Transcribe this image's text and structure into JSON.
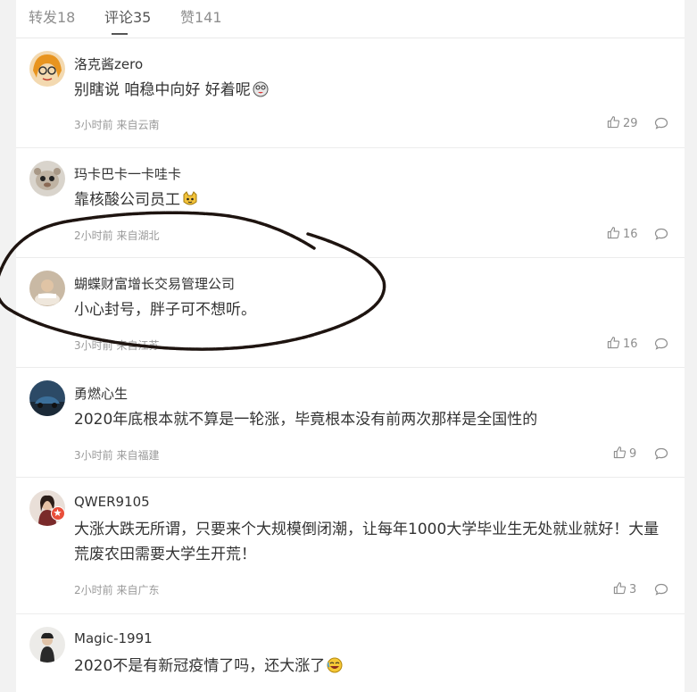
{
  "tabs": [
    {
      "label": "转发18"
    },
    {
      "label": "评论35"
    },
    {
      "label": "赞141"
    }
  ],
  "comments": [
    {
      "user": "洛克酱zero",
      "text": "别瞎说 咱稳中向好 好着呢",
      "meta": "3小时前 来自云南",
      "likes": "29"
    },
    {
      "user": "玛卡巴卡一卡哇卡",
      "text": "靠核酸公司员工",
      "meta": "2小时前 来自湖北",
      "likes": "16"
    },
    {
      "user": "蝴蝶财富增长交易管理公司",
      "text": "小心封号，胖子可不想听。",
      "meta": "3小时前 来自江苏",
      "likes": "16"
    },
    {
      "user": "勇燃心生",
      "text": "2020年底根本就不算是一轮涨，毕竟根本没有前两次那样是全国性的",
      "meta": "3小时前 来自福建",
      "likes": "9"
    },
    {
      "user": "QWER9105",
      "text": "大涨大跌无所谓，只要来个大规模倒闭潮，让每年1000大学毕业生无处就业就好！大量荒废农田需要大学生开荒！",
      "meta": "2小时前 来自广东",
      "likes": "3"
    },
    {
      "user": "Magic-1991",
      "text": "2020不是有新冠疫情了吗，还大涨了",
      "meta": "",
      "likes": ""
    }
  ],
  "colors": {
    "annotation_ink": "#1e1410",
    "vip": "#e94e3a"
  }
}
